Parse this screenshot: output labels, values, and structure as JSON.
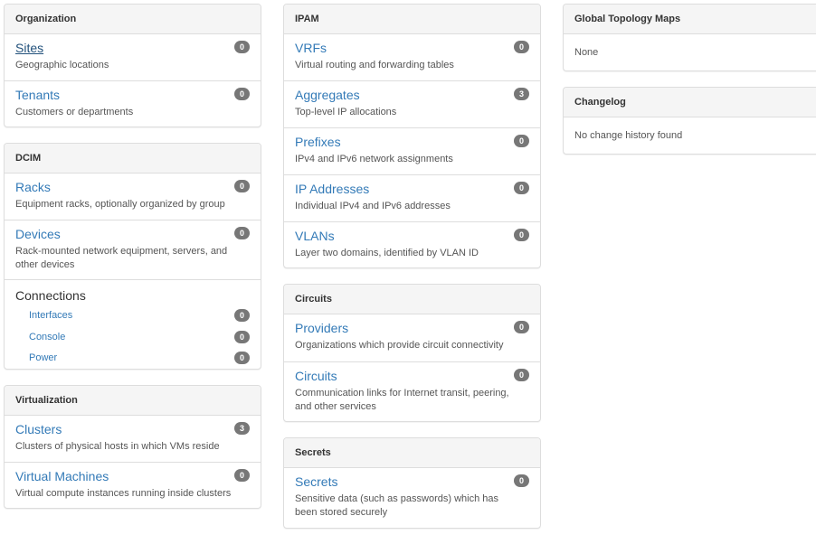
{
  "organization": {
    "title": "Organization",
    "sites": {
      "label": "Sites",
      "desc": "Geographic locations",
      "count": "0"
    },
    "tenants": {
      "label": "Tenants",
      "desc": "Customers or departments",
      "count": "0"
    }
  },
  "dcim": {
    "title": "DCIM",
    "racks": {
      "label": "Racks",
      "desc": "Equipment racks, optionally organized by group",
      "count": "0"
    },
    "devices": {
      "label": "Devices",
      "desc": "Rack-mounted network equipment, servers, and other devices",
      "count": "0"
    },
    "connections": {
      "label": "Connections",
      "interfaces": {
        "label": "Interfaces",
        "count": "0"
      },
      "console": {
        "label": "Console",
        "count": "0"
      },
      "power": {
        "label": "Power",
        "count": "0"
      }
    }
  },
  "virtualization": {
    "title": "Virtualization",
    "clusters": {
      "label": "Clusters",
      "desc": "Clusters of physical hosts in which VMs reside",
      "count": "3"
    },
    "vms": {
      "label": "Virtual Machines",
      "desc": "Virtual compute instances running inside clusters",
      "count": "0"
    }
  },
  "ipam": {
    "title": "IPAM",
    "vrfs": {
      "label": "VRFs",
      "desc": "Virtual routing and forwarding tables",
      "count": "0"
    },
    "aggregates": {
      "label": "Aggregates",
      "desc": "Top-level IP allocations",
      "count": "3"
    },
    "prefixes": {
      "label": "Prefixes",
      "desc": "IPv4 and IPv6 network assignments",
      "count": "0"
    },
    "ip_addresses": {
      "label": "IP Addresses",
      "desc": "Individual IPv4 and IPv6 addresses",
      "count": "0"
    },
    "vlans": {
      "label": "VLANs",
      "desc": "Layer two domains, identified by VLAN ID",
      "count": "0"
    }
  },
  "circuits": {
    "title": "Circuits",
    "providers": {
      "label": "Providers",
      "desc": "Organizations which provide circuit connectivity",
      "count": "0"
    },
    "circuits": {
      "label": "Circuits",
      "desc": "Communication links for Internet transit, peering, and other services",
      "count": "0"
    }
  },
  "secrets": {
    "title": "Secrets",
    "secrets": {
      "label": "Secrets",
      "desc": "Sensitive data (such as passwords) which has been stored securely",
      "count": "0"
    }
  },
  "topology": {
    "title": "Global Topology Maps",
    "body": "None"
  },
  "changelog": {
    "title": "Changelog",
    "body": "No change history found"
  }
}
